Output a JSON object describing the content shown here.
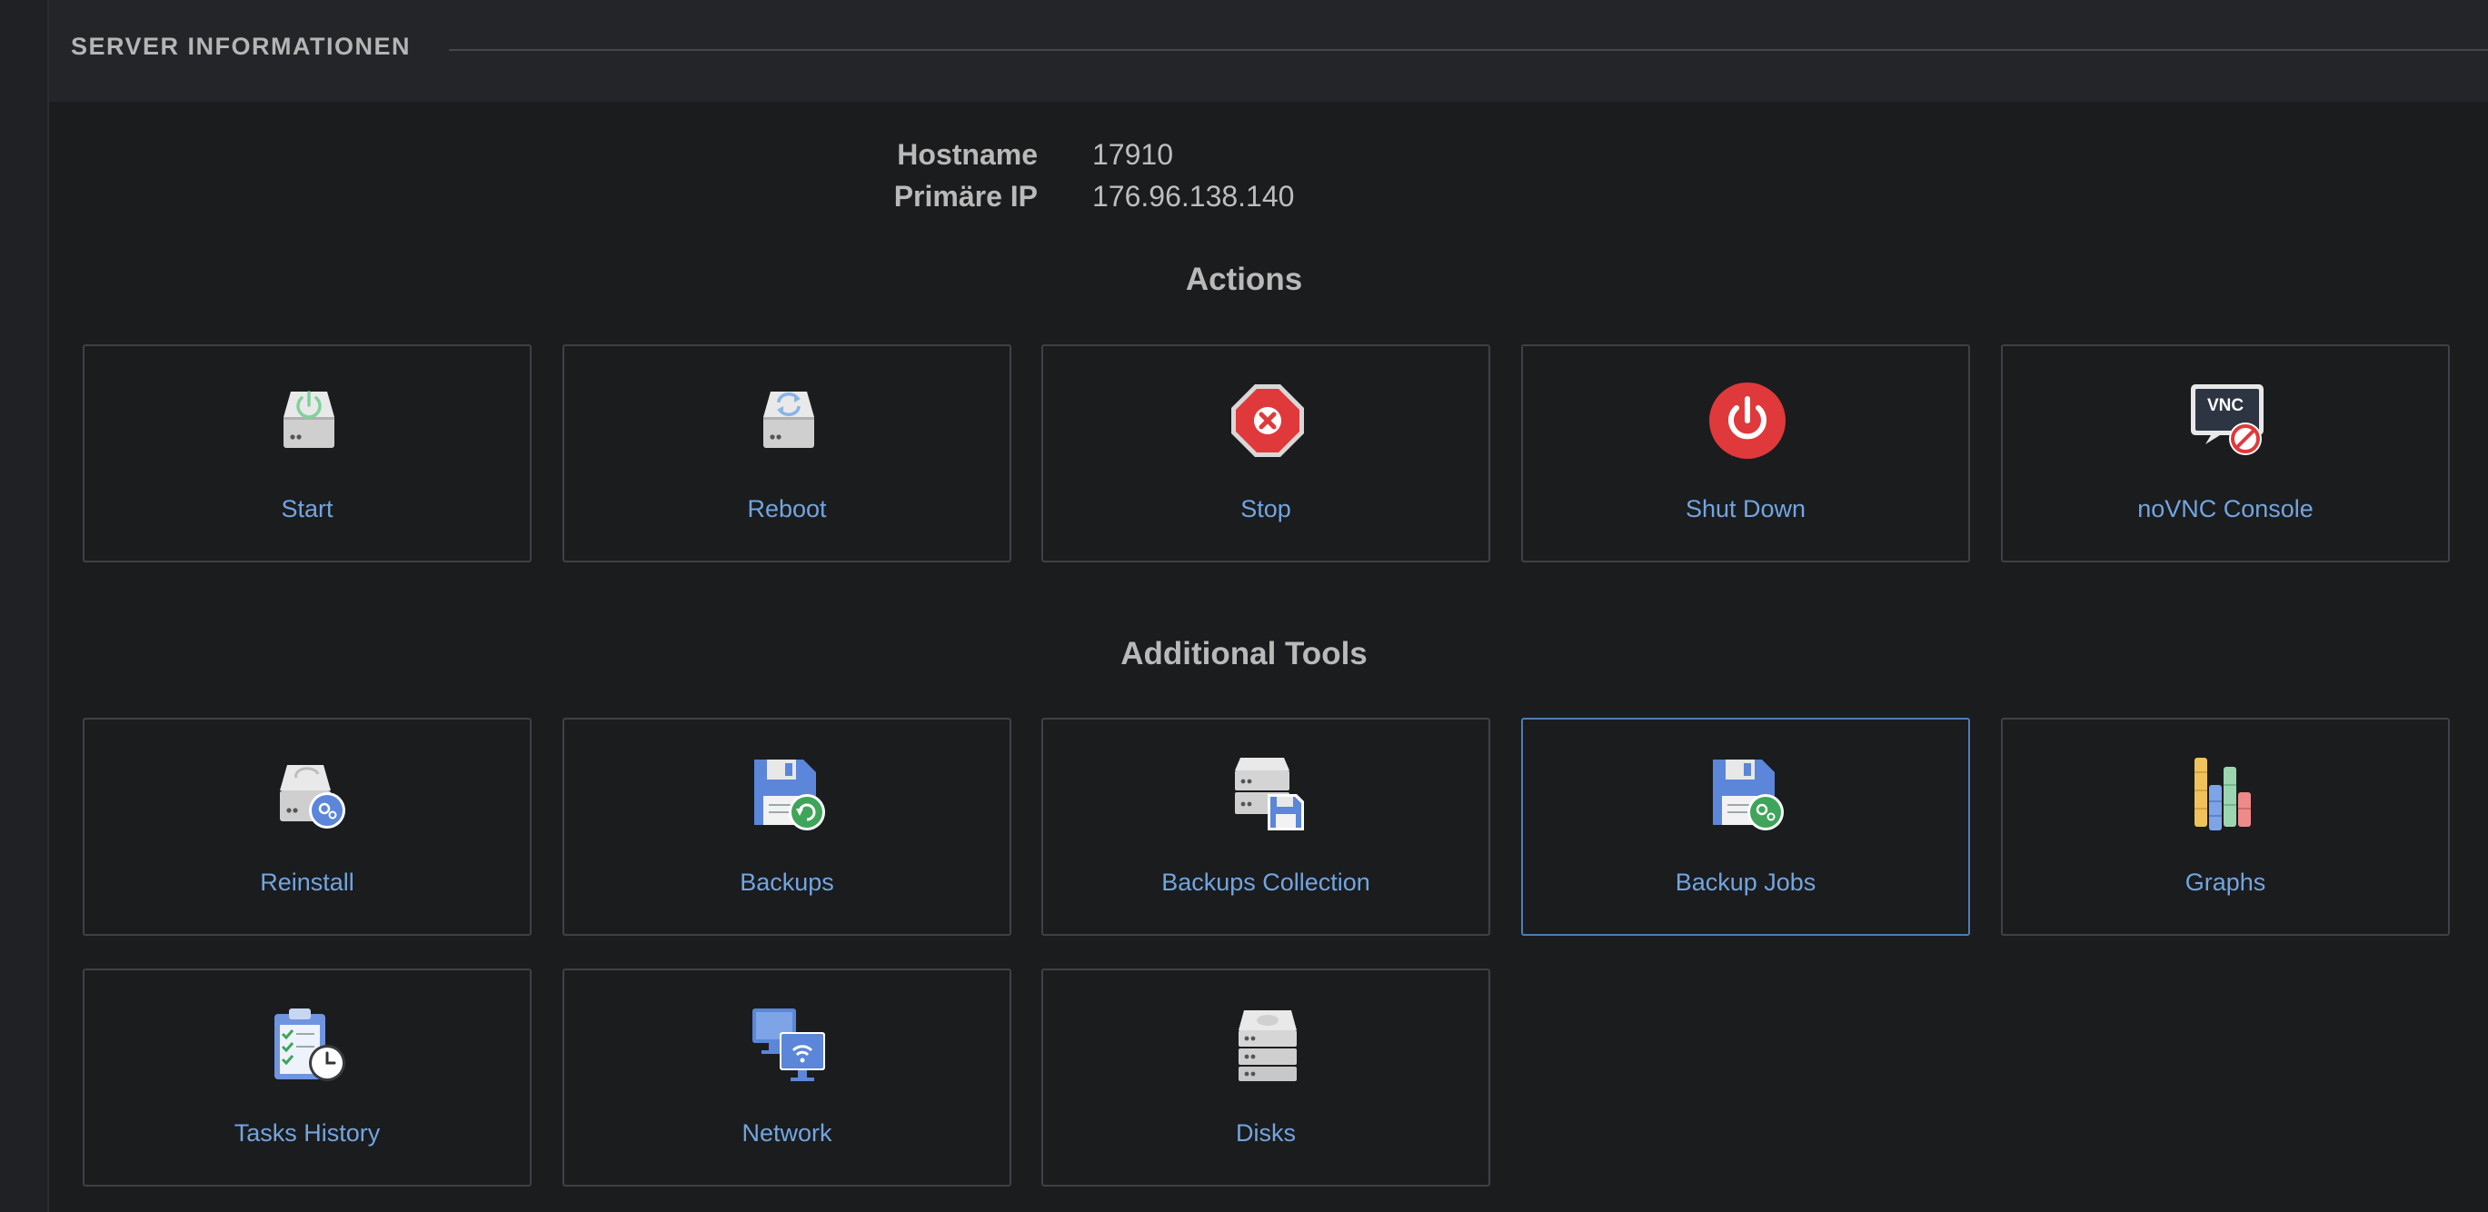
{
  "panel": {
    "title": "SERVER INFORMATIONEN"
  },
  "server": {
    "hostname_label": "Hostname",
    "hostname_value": "17910",
    "ip_label": "Primäre IP",
    "ip_value": "176.96.138.140"
  },
  "sections": {
    "actions_title": "Actions",
    "tools_title": "Additional Tools"
  },
  "actions": [
    {
      "label": "Start",
      "icon": "server-start-icon"
    },
    {
      "label": "Reboot",
      "icon": "server-reboot-icon"
    },
    {
      "label": "Stop",
      "icon": "stop-sign-icon"
    },
    {
      "label": "Shut Down",
      "icon": "power-icon"
    },
    {
      "label": "noVNC Console",
      "icon": "vnc-console-icon"
    }
  ],
  "tools": [
    {
      "label": "Reinstall",
      "icon": "reinstall-icon"
    },
    {
      "label": "Backups",
      "icon": "backup-floppy-icon"
    },
    {
      "label": "Backups Collection",
      "icon": "backup-collection-icon"
    },
    {
      "label": "Backup Jobs",
      "icon": "backup-jobs-icon",
      "selected": true
    },
    {
      "label": "Graphs",
      "icon": "graphs-icon"
    },
    {
      "label": "Tasks History",
      "icon": "tasks-history-icon"
    },
    {
      "label": "Network",
      "icon": "network-icon"
    },
    {
      "label": "Disks",
      "icon": "disks-icon"
    }
  ],
  "colors": {
    "link": "#72a5e0",
    "selected_border": "#4f7cb5",
    "tile_border": "#3f4146"
  }
}
